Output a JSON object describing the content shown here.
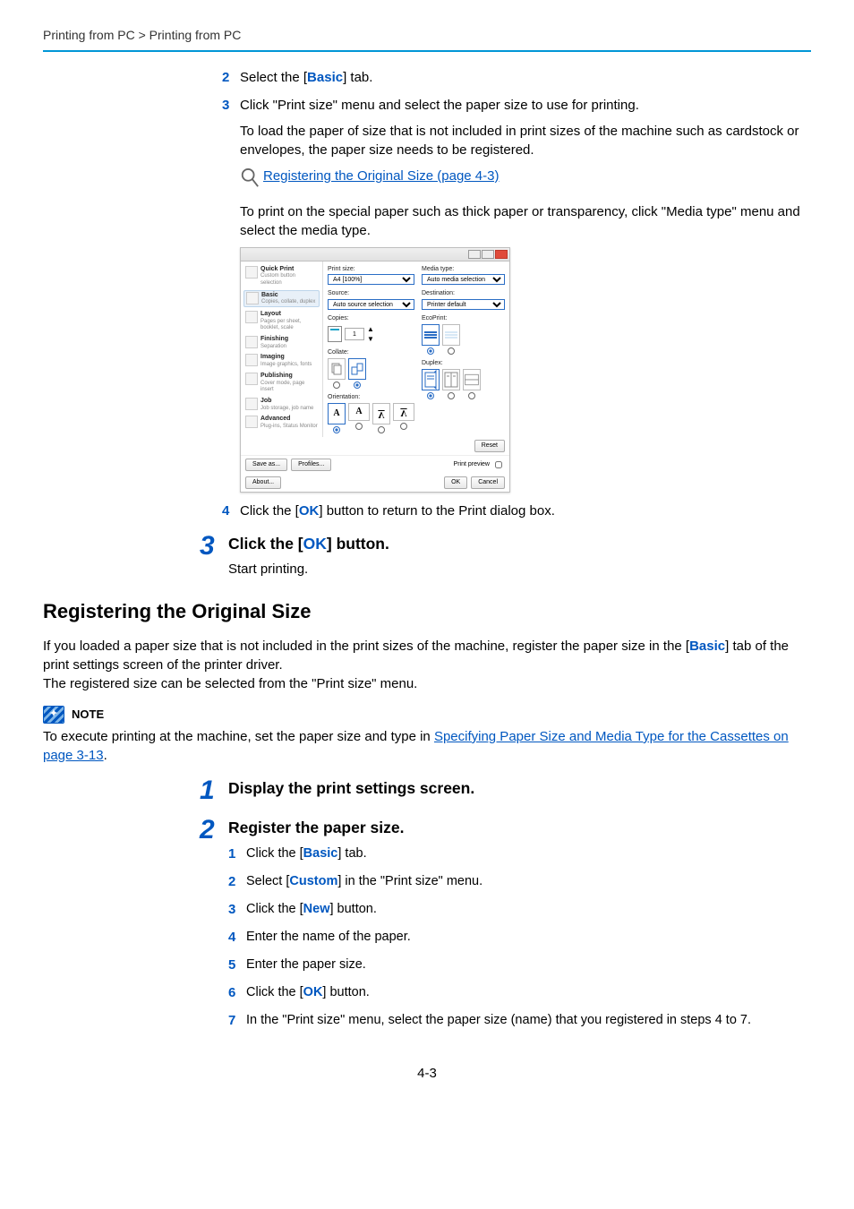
{
  "header": {
    "breadcrumb_left": "Printing from PC",
    "breadcrumb_sep": " > ",
    "breadcrumb_right": "Printing from PC"
  },
  "top_steps": {
    "s2": {
      "num": "2",
      "before": "Select the [",
      "em": "Basic",
      "after": "] tab."
    },
    "s3": {
      "num": "3",
      "text": "Click \"Print size\" menu and select the paper size to use for printing.",
      "para1": "To load the paper of size that is not included in print sizes of the machine such as cardstock or envelopes, the paper size needs to be registered.",
      "link": "Registering the Original Size (page 4-3)",
      "para2": "To print on the special paper such as thick paper or transparency, click \"Media type\" menu and select the media type."
    },
    "s4": {
      "num": "4",
      "before": "Click the [",
      "em": "OK",
      "after": "] button to return to the Print dialog box."
    }
  },
  "bigstep3": {
    "num": "3",
    "title_before": "Click the [",
    "title_em": "OK",
    "title_after": "] button.",
    "text": "Start printing."
  },
  "section": {
    "heading": "Registering the Original Size",
    "p1_before": "If you loaded a paper size that is not included in the print sizes of the machine, register the paper size in the [",
    "p1_em": "Basic",
    "p1_after": "] tab of the print settings screen of the printer driver.",
    "p2": "The registered size can be selected from the \"Print size\" menu."
  },
  "note": {
    "label": "NOTE",
    "before": "To execute printing at the machine, set the paper size and type in ",
    "link": "Specifying Paper Size and Media Type for the Cassettes on page 3-13",
    "after": "."
  },
  "bigstep1": {
    "num": "1",
    "title": "Display the print settings screen."
  },
  "bigstep2": {
    "num": "2",
    "title": "Register the paper size.",
    "items": {
      "i1": {
        "num": "1",
        "before": "Click the [",
        "em": "Basic",
        "after": "] tab."
      },
      "i2": {
        "num": "2",
        "before": "Select [",
        "em": "Custom",
        "after": "] in the \"Print size\" menu."
      },
      "i3": {
        "num": "3",
        "before": "Click the [",
        "em": "New",
        "after": "] button."
      },
      "i4": {
        "num": "4",
        "text": "Enter the name of the paper."
      },
      "i5": {
        "num": "5",
        "text": "Enter the paper size."
      },
      "i6": {
        "num": "6",
        "before": "Click the [",
        "em": "OK",
        "after": "] button."
      },
      "i7": {
        "num": "7",
        "text": "In the \"Print size\" menu, select the paper size (name) that you registered in steps 4 to 7."
      }
    }
  },
  "pagenum": "4-3",
  "dialog": {
    "sidebar": {
      "quickprint": {
        "t": "Quick Print",
        "s": "Custom button selection"
      },
      "basic": {
        "t": "Basic",
        "s": "Copies, collate, duplex"
      },
      "layout": {
        "t": "Layout",
        "s": "Pages per sheet, booklet, scale"
      },
      "finishing": {
        "t": "Finishing",
        "s": "Separation"
      },
      "imaging": {
        "t": "Imaging",
        "s": "Image graphics, fonts"
      },
      "publishing": {
        "t": "Publishing",
        "s": "Cover mode, page insert"
      },
      "job": {
        "t": "Job",
        "s": "Job storage, job name"
      },
      "advanced": {
        "t": "Advanced",
        "s": "Plug-ins, Status Monitor"
      }
    },
    "left": {
      "printsize_label": "Print size:",
      "printsize_value": "A4 [100%]",
      "source_label": "Source:",
      "source_value": "Auto source selection",
      "copies_label": "Copies:",
      "copies_value": "1",
      "collate_label": "Collate:",
      "orientation_label": "Orientation:"
    },
    "right": {
      "mediatype_label": "Media type:",
      "mediatype_value": "Auto media selection",
      "destination_label": "Destination:",
      "destination_value": "Printer default",
      "ecoprint_label": "EcoPrint:",
      "duplex_label": "Duplex:"
    },
    "footer": {
      "reset": "Reset",
      "saveas": "Save as...",
      "profiles": "Profiles...",
      "preview": "Print preview",
      "about": "About...",
      "ok": "OK",
      "cancel": "Cancel"
    }
  }
}
